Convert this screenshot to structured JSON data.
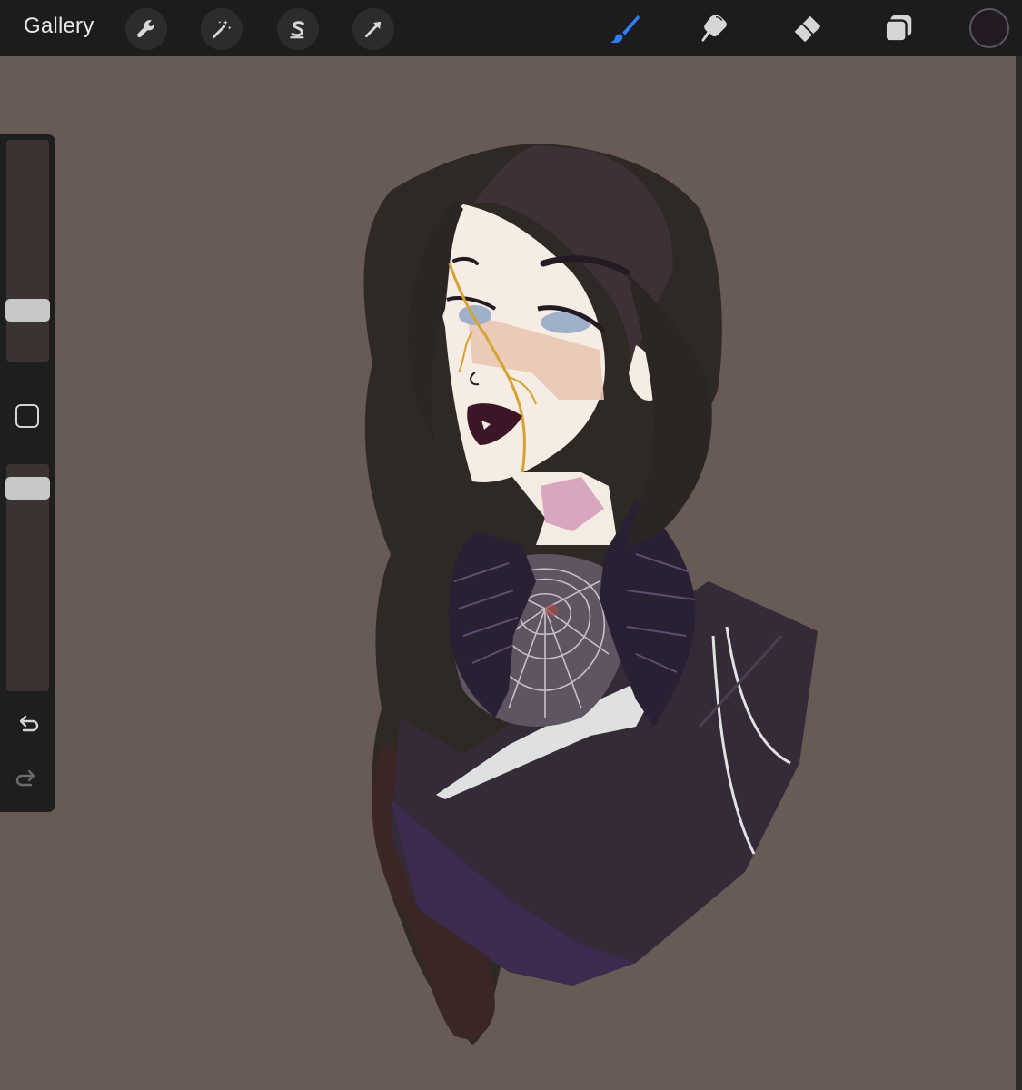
{
  "toolbar": {
    "gallery_label": "Gallery",
    "left_tools": [
      "wrench-icon",
      "magic-wand-icon",
      "selection-s-icon",
      "transform-arrow-icon"
    ],
    "right_tools": [
      "brush-icon",
      "smudge-icon",
      "eraser-icon",
      "layers-icon"
    ],
    "active_tool": "brush-icon",
    "active_color": "#241a24",
    "accent_color": "#2f7df6"
  },
  "sidebar": {
    "brush_size_level": 0.2,
    "opacity_level": 0.94,
    "controls": [
      "brush-size-slider",
      "modify-button",
      "opacity-slider",
      "undo-button",
      "redo-button"
    ]
  },
  "canvas": {
    "background_color": "#685a55"
  }
}
